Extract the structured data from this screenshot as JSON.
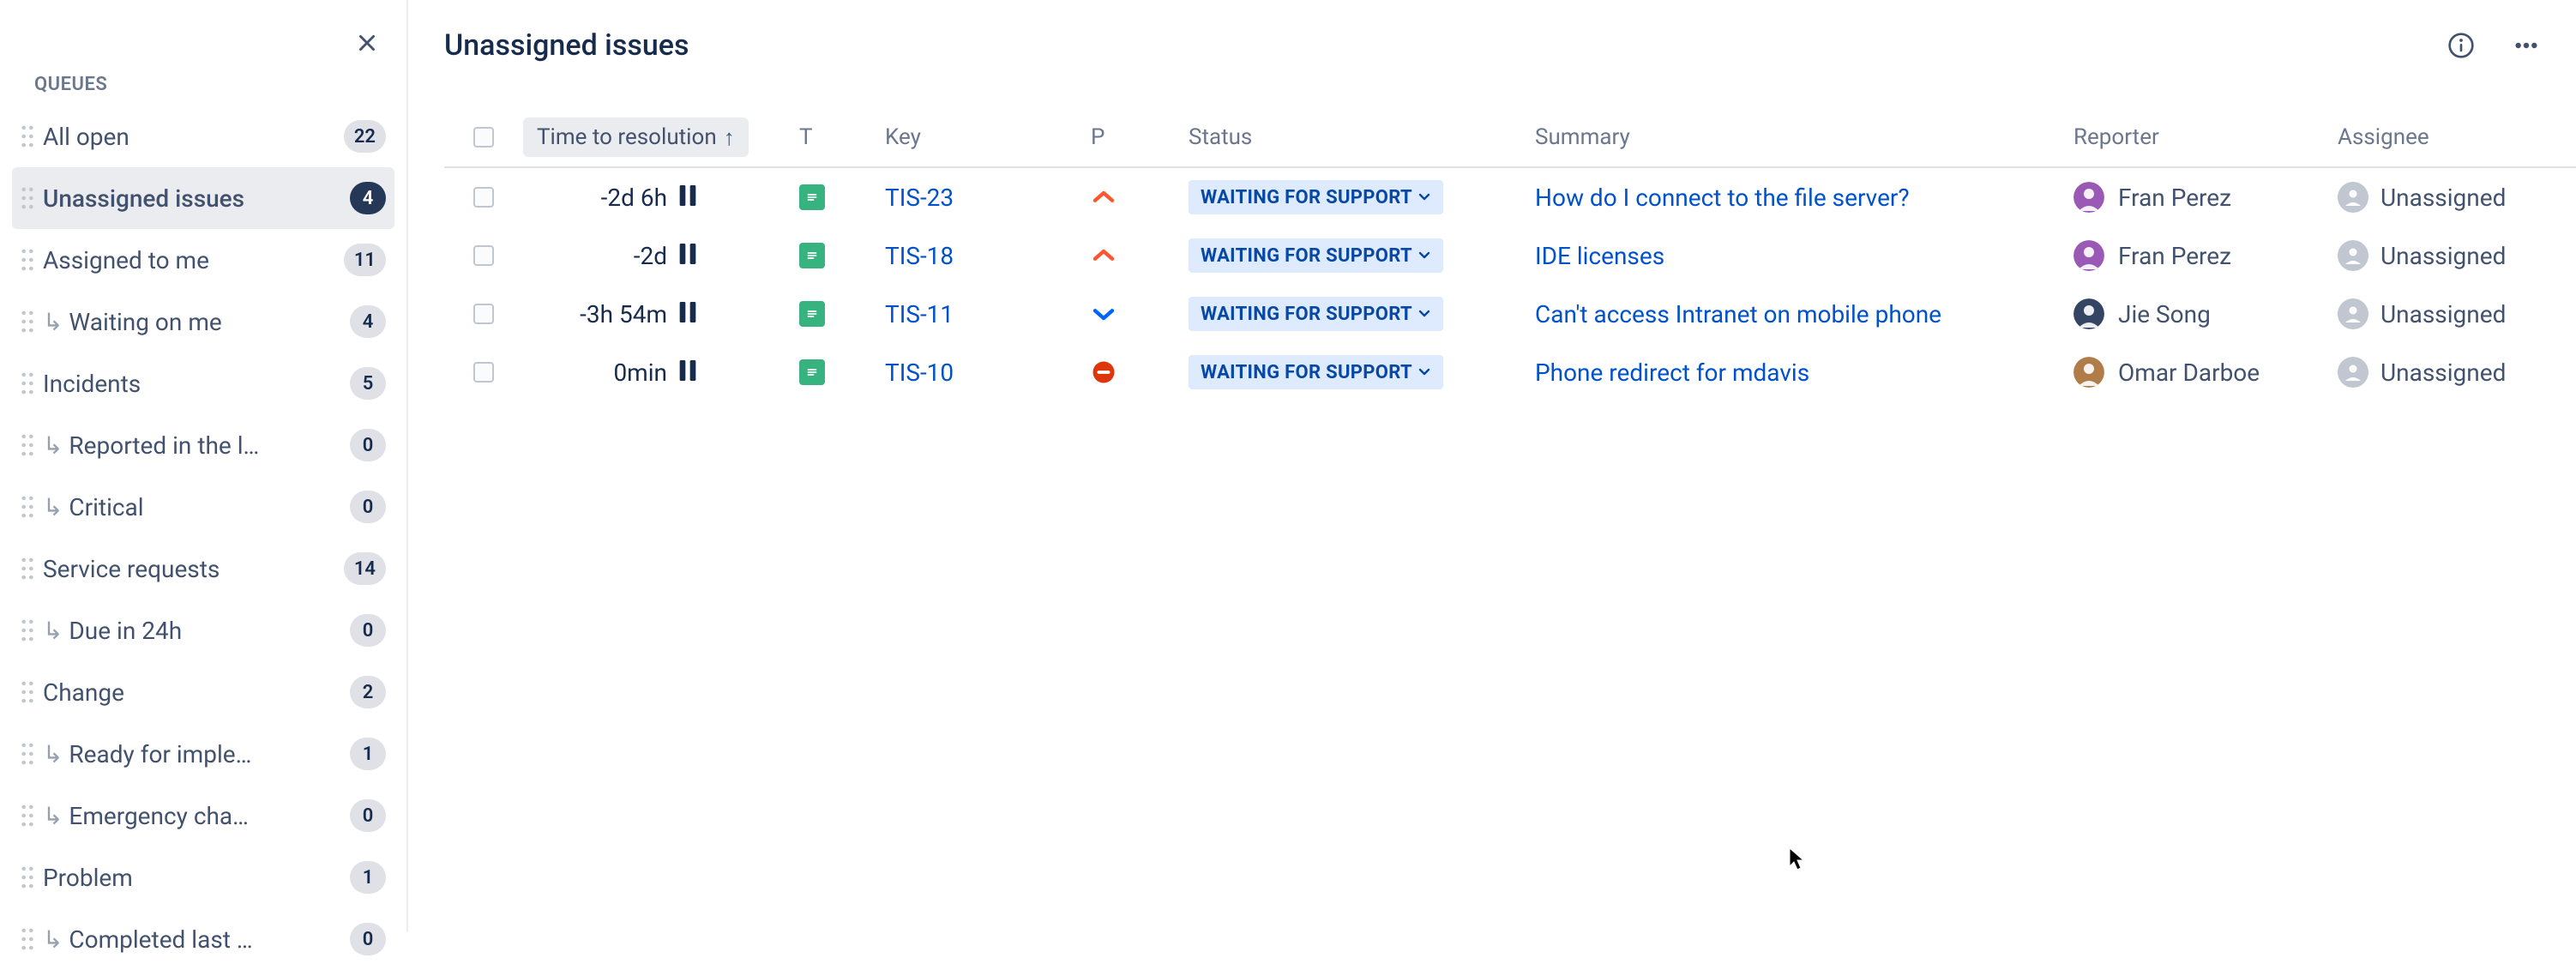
{
  "sidebar": {
    "section_label": "QUEUES",
    "items": [
      {
        "label": "All open",
        "count": 22,
        "selected": false,
        "child": false
      },
      {
        "label": "Unassigned issues",
        "count": 4,
        "selected": true,
        "child": false
      },
      {
        "label": "Assigned to me",
        "count": 11,
        "selected": false,
        "child": false
      },
      {
        "label": "Waiting on me",
        "count": 4,
        "selected": false,
        "child": true
      },
      {
        "label": "Incidents",
        "count": 5,
        "selected": false,
        "child": false
      },
      {
        "label": "Reported in the l…",
        "count": 0,
        "selected": false,
        "child": true
      },
      {
        "label": "Critical",
        "count": 0,
        "selected": false,
        "child": true
      },
      {
        "label": "Service requests",
        "count": 14,
        "selected": false,
        "child": false
      },
      {
        "label": "Due in 24h",
        "count": 0,
        "selected": false,
        "child": true
      },
      {
        "label": "Change",
        "count": 2,
        "selected": false,
        "child": false
      },
      {
        "label": "Ready for imple…",
        "count": 1,
        "selected": false,
        "child": true
      },
      {
        "label": "Emergency cha…",
        "count": 0,
        "selected": false,
        "child": true
      },
      {
        "label": "Problem",
        "count": 1,
        "selected": false,
        "child": false
      },
      {
        "label": "Completed last …",
        "count": 0,
        "selected": false,
        "child": true
      }
    ]
  },
  "header": {
    "title": "Unassigned issues"
  },
  "table": {
    "columns": {
      "time": "Time to resolution",
      "sort_dir": "↑",
      "type": "T",
      "key": "Key",
      "priority": "P",
      "status": "Status",
      "summary": "Summary",
      "reporter": "Reporter",
      "assignee": "Assignee"
    },
    "status_label": "WAITING FOR SUPPORT",
    "unassigned_label": "Unassigned",
    "rows": [
      {
        "time": "-2d 6h",
        "key": "TIS-23",
        "priority": "high",
        "summary": "How do I connect to the file server?",
        "reporter": "Fran Perez",
        "avatar_color": "#9b59b6"
      },
      {
        "time": "-2d",
        "key": "TIS-18",
        "priority": "high",
        "summary": "IDE licenses",
        "reporter": "Fran Perez",
        "avatar_color": "#9b59b6"
      },
      {
        "time": "-3h 54m",
        "key": "TIS-11",
        "priority": "low",
        "summary": "Can't access Intranet on mobile phone",
        "reporter": "Jie Song",
        "avatar_color": "#344563"
      },
      {
        "time": "0min",
        "key": "TIS-10",
        "priority": "blocker",
        "summary": "Phone redirect for mdavis",
        "reporter": "Omar Darboe",
        "avatar_color": "#b07d4a"
      }
    ]
  }
}
